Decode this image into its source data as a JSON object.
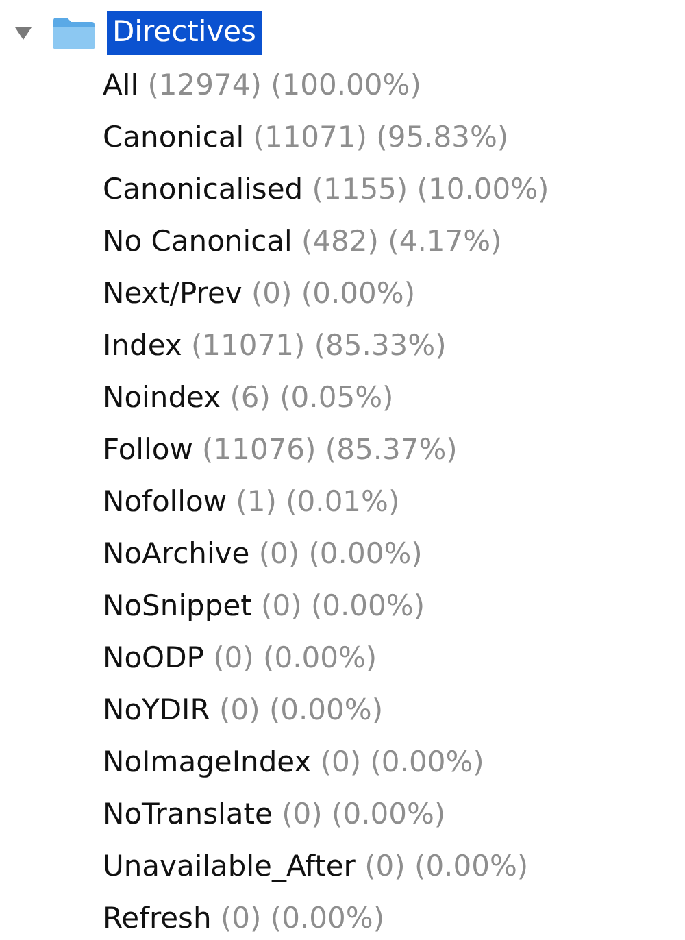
{
  "tree": {
    "label": "Directives",
    "expanded": true,
    "selected": true,
    "children": [
      {
        "label": "All",
        "count": "(12974)",
        "percent": "(100.00%)"
      },
      {
        "label": "Canonical",
        "count": "(11071)",
        "percent": "(95.83%)"
      },
      {
        "label": "Canonicalised",
        "count": "(1155)",
        "percent": "(10.00%)"
      },
      {
        "label": "No Canonical",
        "count": "(482)",
        "percent": "(4.17%)"
      },
      {
        "label": "Next/Prev",
        "count": "(0)",
        "percent": "(0.00%)"
      },
      {
        "label": "Index",
        "count": "(11071)",
        "percent": "(85.33%)"
      },
      {
        "label": "Noindex",
        "count": "(6)",
        "percent": "(0.05%)"
      },
      {
        "label": "Follow",
        "count": "(11076)",
        "percent": "(85.37%)"
      },
      {
        "label": "Nofollow",
        "count": "(1)",
        "percent": "(0.01%)"
      },
      {
        "label": "NoArchive",
        "count": "(0)",
        "percent": "(0.00%)"
      },
      {
        "label": "NoSnippet",
        "count": "(0)",
        "percent": "(0.00%)"
      },
      {
        "label": "NoODP",
        "count": "(0)",
        "percent": "(0.00%)"
      },
      {
        "label": "NoYDIR",
        "count": "(0)",
        "percent": "(0.00%)"
      },
      {
        "label": "NoImageIndex",
        "count": "(0)",
        "percent": "(0.00%)"
      },
      {
        "label": "NoTranslate",
        "count": "(0)",
        "percent": "(0.00%)"
      },
      {
        "label": "Unavailable_After",
        "count": "(0)",
        "percent": "(0.00%)"
      },
      {
        "label": "Refresh",
        "count": "(0)",
        "percent": "(0.00%)"
      }
    ]
  }
}
